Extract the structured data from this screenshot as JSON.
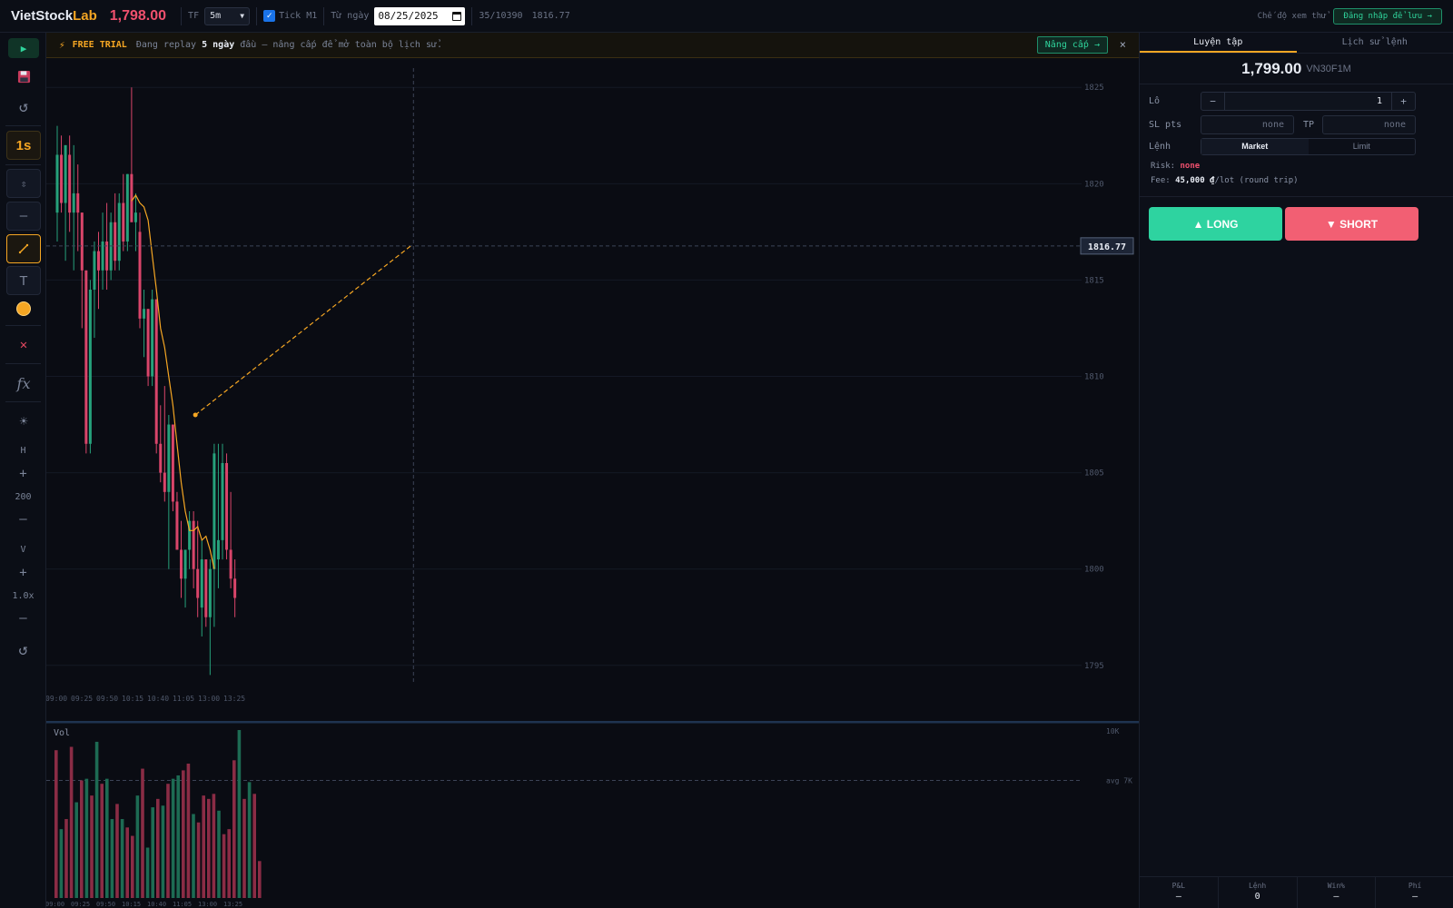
{
  "topbar": {
    "logo_main": "VietStock",
    "logo_accent": "Lab",
    "price": "1,798.00",
    "tf_label": "TF",
    "tf_value": "5m",
    "tick_label": "Tick M1",
    "from_label": "Từ ngày",
    "date_value": "08/25/2025",
    "progress": "35/10390",
    "last_price": "1816.77",
    "mode_label": "Chế độ xem thử",
    "login_label": "Đăng nhập để lưu →"
  },
  "toolbar": {
    "play_icon": "play-icon",
    "speed_label": "1s",
    "h_label": "H",
    "h_value": "200",
    "v_label": "V",
    "v_value": "1.0x",
    "fx_label": "fx",
    "color_accent": "#f5a623",
    "plus": "+",
    "minus": "–"
  },
  "banner": {
    "tag": "FREE TRIAL",
    "msg_pre": "Đang replay",
    "msg_bold": "5 ngày",
    "msg_post": "đầu — nâng cấp để mở toàn bộ lịch sử.",
    "upgrade_label": "Nâng cấp →",
    "close_label": "×"
  },
  "chart": {
    "price_ticks": [
      "1825",
      "1820",
      "1815",
      "1810",
      "1805",
      "1800",
      "1795"
    ],
    "time_ticks": [
      "09:00",
      "09:25",
      "09:50",
      "10:15",
      "10:40",
      "11:05",
      "13:00",
      "13:25"
    ],
    "current_price_label": "1816.77",
    "vol_label": "Vol",
    "vol_max_label": "10K",
    "vol_avg_label": "avg 7K"
  },
  "colors": {
    "up": "#26a17b",
    "down": "#d9456a",
    "ma": "#f5a623",
    "long": "#2ed3a0",
    "short": "#f25f73"
  },
  "chart_data": {
    "type": "candlestick",
    "ylim": [
      1794,
      1826
    ],
    "candles": [
      {
        "o": 1818.5,
        "h": 1823.0,
        "l": 1817.0,
        "c": 1821.5
      },
      {
        "o": 1821.5,
        "h": 1822.5,
        "l": 1818.5,
        "c": 1819.0
      },
      {
        "o": 1819.0,
        "h": 1822.0,
        "l": 1816.0,
        "c": 1822.0
      },
      {
        "o": 1821.5,
        "h": 1822.5,
        "l": 1817.5,
        "c": 1818.5
      },
      {
        "o": 1818.5,
        "h": 1822.0,
        "l": 1815.5,
        "c": 1819.5
      },
      {
        "o": 1819.5,
        "h": 1821.0,
        "l": 1816.5,
        "c": 1818.5
      },
      {
        "o": 1818.5,
        "h": 1818.5,
        "l": 1812.5,
        "c": 1815.5
      },
      {
        "o": 1815.5,
        "h": 1815.5,
        "l": 1806.0,
        "c": 1806.5
      },
      {
        "o": 1806.5,
        "h": 1815.0,
        "l": 1806.0,
        "c": 1814.5
      },
      {
        "o": 1814.5,
        "h": 1817.0,
        "l": 1812.0,
        "c": 1816.5
      },
      {
        "o": 1816.5,
        "h": 1817.5,
        "l": 1813.5,
        "c": 1815.5
      },
      {
        "o": 1815.5,
        "h": 1818.5,
        "l": 1814.5,
        "c": 1817.0
      },
      {
        "o": 1817.0,
        "h": 1819.0,
        "l": 1814.5,
        "c": 1815.5
      },
      {
        "o": 1815.5,
        "h": 1818.5,
        "l": 1815.0,
        "c": 1818.0
      },
      {
        "o": 1818.0,
        "h": 1819.5,
        "l": 1815.5,
        "c": 1816.0
      },
      {
        "o": 1816.0,
        "h": 1819.5,
        "l": 1815.5,
        "c": 1819.0
      },
      {
        "o": 1819.0,
        "h": 1820.5,
        "l": 1816.5,
        "c": 1817.0
      },
      {
        "o": 1817.0,
        "h": 1820.5,
        "l": 1816.5,
        "c": 1820.5
      },
      {
        "o": 1820.5,
        "h": 1825.0,
        "l": 1818.5,
        "c": 1818.0
      },
      {
        "o": 1818.0,
        "h": 1819.5,
        "l": 1816.5,
        "c": 1818.5
      },
      {
        "o": 1817.5,
        "h": 1818.5,
        "l": 1812.5,
        "c": 1813.0
      },
      {
        "o": 1813.0,
        "h": 1814.5,
        "l": 1811.0,
        "c": 1813.5
      },
      {
        "o": 1813.5,
        "h": 1813.5,
        "l": 1809.5,
        "c": 1810.0
      },
      {
        "o": 1810.0,
        "h": 1814.5,
        "l": 1809.5,
        "c": 1814.0
      },
      {
        "o": 1814.0,
        "h": 1814.0,
        "l": 1806.0,
        "c": 1806.5
      },
      {
        "o": 1806.5,
        "h": 1808.5,
        "l": 1804.5,
        "c": 1805.0
      },
      {
        "o": 1805.0,
        "h": 1809.5,
        "l": 1803.5,
        "c": 1804.0
      },
      {
        "o": 1804.0,
        "h": 1808.0,
        "l": 1800.0,
        "c": 1807.5
      },
      {
        "o": 1807.5,
        "h": 1807.5,
        "l": 1803.0,
        "c": 1803.5
      },
      {
        "o": 1803.5,
        "h": 1804.0,
        "l": 1801.0,
        "c": 1801.0
      },
      {
        "o": 1801.0,
        "h": 1802.5,
        "l": 1798.5,
        "c": 1799.5
      },
      {
        "o": 1799.5,
        "h": 1801.0,
        "l": 1798.0,
        "c": 1801.0
      },
      {
        "o": 1801.0,
        "h": 1803.0,
        "l": 1800.0,
        "c": 1802.5
      },
      {
        "o": 1802.5,
        "h": 1803.0,
        "l": 1799.0,
        "c": 1800.0
      },
      {
        "o": 1800.0,
        "h": 1802.5,
        "l": 1797.5,
        "c": 1798.5
      },
      {
        "o": 1798.0,
        "h": 1801.5,
        "l": 1796.5,
        "c": 1800.5
      },
      {
        "o": 1800.5,
        "h": 1800.5,
        "l": 1797.0,
        "c": 1797.5
      },
      {
        "o": 1797.5,
        "h": 1800.5,
        "l": 1794.5,
        "c": 1800.0
      },
      {
        "o": 1800.0,
        "h": 1806.5,
        "l": 1797.0,
        "c": 1806.0
      },
      {
        "o": 1800.5,
        "h": 1806.5,
        "l": 1799.0,
        "c": 1801.5
      },
      {
        "o": 1801.5,
        "h": 1806.5,
        "l": 1800.5,
        "c": 1805.5
      },
      {
        "o": 1805.5,
        "h": 1806.0,
        "l": 1800.5,
        "c": 1801.0
      },
      {
        "o": 1801.0,
        "h": 1804.0,
        "l": 1799.0,
        "c": 1799.5
      },
      {
        "o": 1799.5,
        "h": 1800.5,
        "l": 1797.5,
        "c": 1798.5
      }
    ],
    "ma": [
      1819.1,
      1819.4,
      1819.0,
      1818.8,
      1818.1,
      1816.3,
      1814.5,
      1812.5,
      1811.5,
      1810.0,
      1808.5,
      1806.5,
      1804.5,
      1803.0,
      1802.0,
      1802.0,
      1802.2,
      1801.5,
      1801.7,
      1801.0,
      1800.0
    ],
    "volumes": [
      8.8,
      4.1,
      4.7,
      9.0,
      5.7,
      7.0,
      7.1,
      6.1,
      9.3,
      6.8,
      7.1,
      4.7,
      5.6,
      4.7,
      4.2,
      3.7,
      6.1,
      7.7,
      3.0,
      5.4,
      5.9,
      5.5,
      6.8,
      7.1,
      7.3,
      7.6,
      8.0,
      5.0,
      4.5,
      6.1,
      5.9,
      6.2,
      5.2,
      3.8,
      4.1,
      8.2,
      10.0,
      5.9,
      6.9,
      6.2,
      2.2
    ],
    "volume_up": [
      false,
      true,
      false,
      false,
      true,
      false,
      true,
      false,
      true,
      false,
      true,
      true,
      false,
      true,
      false,
      false,
      true,
      false,
      true,
      true,
      false,
      true,
      false,
      true,
      true,
      false,
      false,
      true,
      false,
      false,
      false,
      false,
      true,
      false,
      false,
      false,
      true,
      false,
      true,
      false,
      false
    ],
    "vol_ylim": [
      0,
      10
    ],
    "vol_avg": 7.0,
    "current_price": 1816.77,
    "trendline": {
      "from": {
        "index": 33,
        "price": 1808.0
      },
      "to": {
        "index": 86,
        "price": 1816.77
      }
    },
    "crosshair_index": 86
  },
  "panel": {
    "tab_practice": "Luyện tập",
    "tab_history": "Lịch sử lệnh",
    "price": "1,799.00",
    "symbol": "VN30F1M",
    "lot_label": "Lô",
    "lot_value": "1",
    "lot_minus": "−",
    "lot_plus": "+",
    "sl_label": "SL pts",
    "sl_value": "none",
    "tp_label": "TP",
    "tp_value": "none",
    "order_label": "Lệnh",
    "order_market": "Market",
    "order_limit": "Limit",
    "risk_label": "Risk:",
    "risk_value": "none",
    "fee_label": "Fee:",
    "fee_value": "45,000 ₫",
    "fee_suffix": "/lot (round trip)",
    "long_label": "▲ LONG",
    "short_label": "▼ SHORT",
    "stats": [
      {
        "key": "P&L",
        "value": "—"
      },
      {
        "key": "Lệnh",
        "value": "0"
      },
      {
        "key": "Win%",
        "value": "—"
      },
      {
        "key": "Phí",
        "value": "—"
      }
    ]
  }
}
